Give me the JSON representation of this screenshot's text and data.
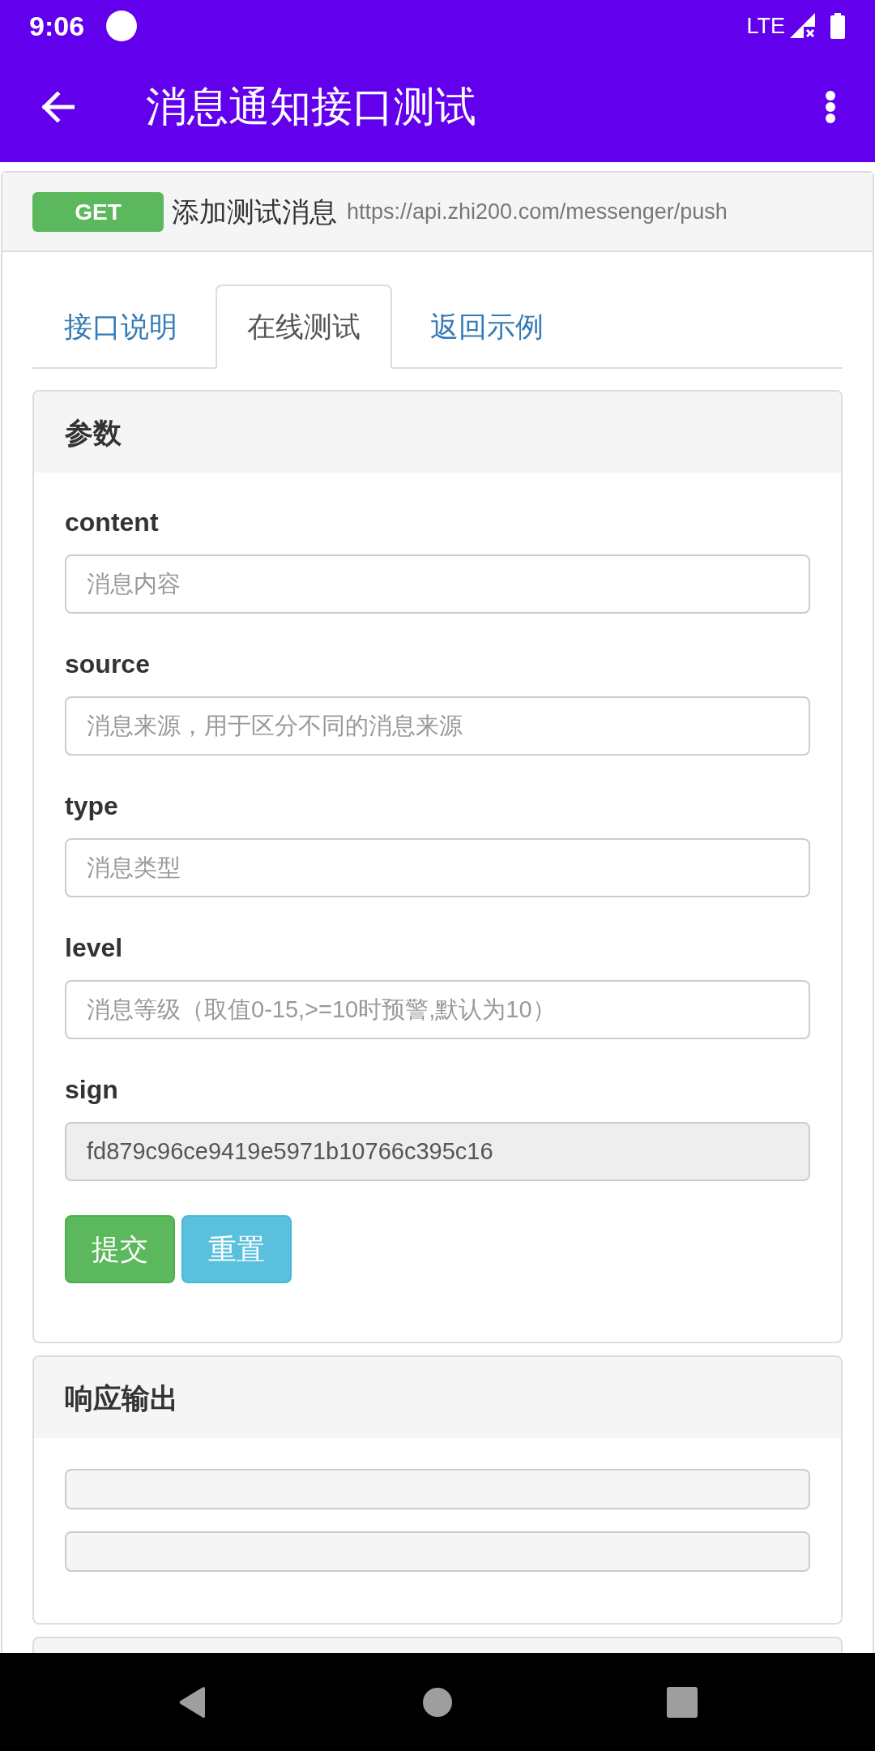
{
  "status_bar": {
    "time": "9:06",
    "network": "LTE"
  },
  "app_bar": {
    "title": "消息通知接口测试"
  },
  "api": {
    "method": "GET",
    "name": "添加测试消息",
    "url": "https://api.zhi200.com/messenger/push"
  },
  "tabs": [
    {
      "label": "接口说明",
      "selected": false
    },
    {
      "label": "在线测试",
      "selected": true
    },
    {
      "label": "返回示例",
      "selected": false
    }
  ],
  "params_panel": {
    "title": "参数",
    "fields": [
      {
        "label": "content",
        "placeholder": "消息内容",
        "readonly": false
      },
      {
        "label": "source",
        "placeholder": "消息来源，用于区分不同的消息来源",
        "readonly": false
      },
      {
        "label": "type",
        "placeholder": "消息类型",
        "readonly": false
      },
      {
        "label": "level",
        "placeholder": "消息等级（取值0-15,>=10时预警,默认为10）",
        "readonly": false
      },
      {
        "label": "sign",
        "value": "fd879c96ce9419e5971b10766c395c16",
        "readonly": true
      }
    ],
    "buttons": [
      {
        "label": "提交",
        "kind": "submit"
      },
      {
        "label": "重置",
        "kind": "reset"
      }
    ]
  },
  "response_panel": {
    "title": "响应输出"
  }
}
